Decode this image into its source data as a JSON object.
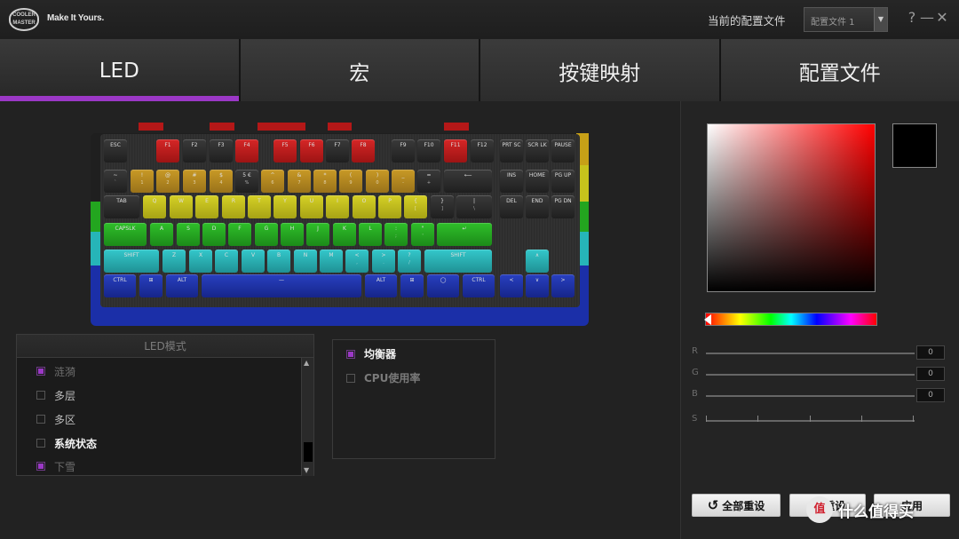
{
  "app": {
    "logo_text": "COOLER MASTER",
    "tagline": "Make It Yours.",
    "profile_label": "当前的配置文件",
    "profile_selected": "配置文件 1",
    "help_symbol": "?",
    "minimize_symbol": "—",
    "close_symbol": "✕"
  },
  "tabs": [
    {
      "label": "LED"
    },
    {
      "label": "宏"
    },
    {
      "label": "按键映射"
    },
    {
      "label": "配置文件"
    }
  ],
  "colors": {
    "accent": "#9b38c6",
    "red": "#c0181c",
    "orange": "#b98a1c",
    "yellow": "#c7c21c",
    "green": "#23a51f",
    "cyan": "#26b5b8",
    "blue": "#1b2fa8"
  },
  "keyboard": {
    "rows": [
      [
        [
          "ESC",
          "",
          0,
          "dark"
        ],
        [
          "F1",
          "",
          1,
          "red"
        ],
        [
          "F2",
          "",
          1,
          "dark"
        ],
        [
          "F3",
          "",
          1,
          "dark"
        ],
        [
          "F4",
          "",
          1,
          "red"
        ],
        [
          "F5",
          "",
          1,
          "red"
        ],
        [
          "F6",
          "",
          1,
          "red"
        ],
        [
          "F7",
          "",
          1,
          "dark"
        ],
        [
          "F8",
          "",
          1,
          "red"
        ],
        [
          "F9",
          "",
          1,
          "dark"
        ],
        [
          "F10",
          "",
          1,
          "dark"
        ],
        [
          "F11",
          "",
          1,
          "red"
        ],
        [
          "F12",
          "",
          1,
          "dark"
        ],
        [
          "PRT SC",
          "",
          1,
          "dark"
        ],
        [
          "SCR LK",
          "",
          1,
          "dark"
        ],
        [
          "PAUSE",
          "",
          1,
          "dark"
        ]
      ],
      [
        [
          "~",
          "`",
          0,
          "dark"
        ],
        [
          "!",
          "1",
          1,
          "orange"
        ],
        [
          "@",
          "2",
          1,
          "orange"
        ],
        [
          "#",
          "3",
          1,
          "orange"
        ],
        [
          "$",
          "4",
          1,
          "orange"
        ],
        [
          "5 €",
          "%",
          1,
          "dark"
        ],
        [
          "^",
          "6",
          1,
          "orange"
        ],
        [
          "&",
          "7",
          1,
          "orange"
        ],
        [
          "*",
          "8",
          1,
          "orange"
        ],
        [
          "(",
          "9",
          1,
          "orange"
        ],
        [
          ")",
          "0",
          1,
          "orange"
        ],
        [
          "_",
          "-",
          1,
          "orange"
        ],
        [
          "=",
          "+",
          1,
          "dark"
        ],
        [
          "⟵",
          "",
          1,
          "dark"
        ],
        [
          "INS",
          "",
          1,
          "dark"
        ],
        [
          "HOME",
          "",
          1,
          "dark"
        ],
        [
          "PG UP",
          "",
          1,
          "dark"
        ]
      ],
      [
        [
          "TAB",
          "",
          0,
          "dark"
        ],
        [
          "Q",
          "",
          1,
          "yellow"
        ],
        [
          "W",
          "",
          1,
          "yellow"
        ],
        [
          "E",
          "",
          1,
          "yellow"
        ],
        [
          "R",
          "",
          1,
          "yellow"
        ],
        [
          "T",
          "",
          1,
          "yellow"
        ],
        [
          "Y",
          "",
          1,
          "yellow"
        ],
        [
          "U",
          "",
          1,
          "yellow"
        ],
        [
          "I",
          "",
          1,
          "yellow"
        ],
        [
          "O",
          "",
          1,
          "yellow"
        ],
        [
          "P",
          "",
          1,
          "yellow"
        ],
        [
          "{",
          "[",
          1,
          "yellow"
        ],
        [
          "}",
          "]",
          1,
          "dark"
        ],
        [
          "|",
          "\\",
          1,
          "dark"
        ],
        [
          "DEL",
          "",
          1,
          "dark"
        ],
        [
          "END",
          "",
          1,
          "dark"
        ],
        [
          "PG DN",
          "",
          1,
          "dark"
        ]
      ],
      [
        [
          "CAPSLK",
          "",
          0,
          "green"
        ],
        [
          "A",
          "",
          1,
          "green"
        ],
        [
          "S",
          "",
          1,
          "green"
        ],
        [
          "D",
          "",
          1,
          "green"
        ],
        [
          "F",
          "",
          1,
          "green"
        ],
        [
          "G",
          "",
          1,
          "green"
        ],
        [
          "H",
          "",
          1,
          "green"
        ],
        [
          "J",
          "",
          1,
          "green"
        ],
        [
          "K",
          "",
          1,
          "green"
        ],
        [
          "L",
          "",
          1,
          "green"
        ],
        [
          ":",
          ";",
          1,
          "green"
        ],
        [
          "\"",
          "'",
          1,
          "green"
        ],
        [
          "↵",
          "",
          1,
          "green"
        ]
      ],
      [
        [
          "SHIFT",
          "",
          0,
          "cyan"
        ],
        [
          "Z",
          "",
          1,
          "cyan"
        ],
        [
          "X",
          "",
          1,
          "cyan"
        ],
        [
          "C",
          "",
          1,
          "cyan"
        ],
        [
          "V",
          "",
          1,
          "cyan"
        ],
        [
          "B",
          "",
          1,
          "cyan"
        ],
        [
          "N",
          "",
          1,
          "cyan"
        ],
        [
          "M",
          "",
          1,
          "cyan"
        ],
        [
          "<",
          ",",
          1,
          "cyan"
        ],
        [
          ">",
          ".",
          1,
          "cyan"
        ],
        [
          "?",
          "/",
          1,
          "cyan"
        ],
        [
          "SHIFT",
          "",
          1,
          "cyan"
        ],
        [
          "∧",
          "",
          1,
          "cyan"
        ]
      ],
      [
        [
          "CTRL",
          "",
          0,
          "blue"
        ],
        [
          "⊞",
          "",
          1,
          "blue"
        ],
        [
          "ALT",
          "",
          1,
          "blue"
        ],
        [
          "—",
          "",
          1,
          "blue"
        ],
        [
          "ALT",
          "",
          1,
          "blue"
        ],
        [
          "⊞",
          "",
          1,
          "blue"
        ],
        [
          "◯",
          "",
          1,
          "blue"
        ],
        [
          "CTRL",
          "",
          1,
          "blue"
        ],
        [
          "<",
          "",
          1,
          "blue"
        ],
        [
          "∨",
          "",
          1,
          "blue"
        ],
        [
          ">",
          "",
          1,
          "blue"
        ]
      ]
    ]
  },
  "led_modes": {
    "title": "LED模式",
    "items": [
      {
        "label": "涟漪",
        "checked": true,
        "active": false
      },
      {
        "label": "多层",
        "checked": false,
        "active": false
      },
      {
        "label": "多区",
        "checked": false,
        "active": false
      },
      {
        "label": "系统状态",
        "checked": false,
        "active": true
      },
      {
        "label": "下雪",
        "checked": true,
        "active": false
      }
    ],
    "scroll_up": "▲",
    "scroll_down": "▼"
  },
  "options": {
    "items": [
      {
        "label": "均衡器",
        "checked": true,
        "active": true
      },
      {
        "label": "CPU使用率",
        "checked": false,
        "active": false
      }
    ]
  },
  "color_picker": {
    "selected_color": "#000000",
    "sliders": [
      {
        "label": "R",
        "value": "0"
      },
      {
        "label": "G",
        "value": "0"
      },
      {
        "label": "B",
        "value": "0"
      },
      {
        "label": "S",
        "value": ""
      }
    ]
  },
  "buttons": {
    "reset_all": "全部重设",
    "reset": "重设",
    "apply": "应用",
    "reset_icon": "↺"
  },
  "watermark": {
    "icon_text": "值",
    "text": "什么值得买"
  }
}
